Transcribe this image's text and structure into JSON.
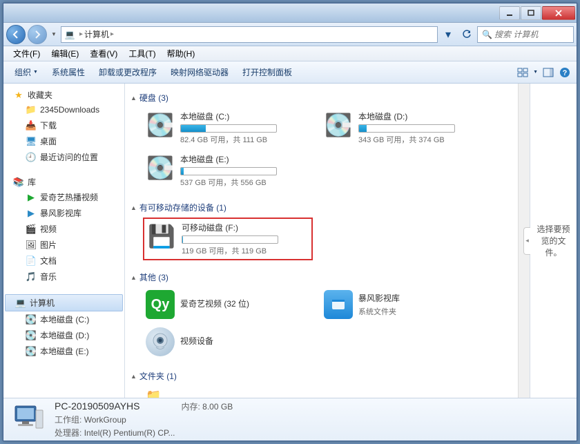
{
  "window": {
    "title": "计算机"
  },
  "nav": {
    "breadcrumb_icon": "💻",
    "breadcrumb": "计算机",
    "search_placeholder": "搜索 计算机"
  },
  "menu": [
    "文件(F)",
    "编辑(E)",
    "查看(V)",
    "工具(T)",
    "帮助(H)"
  ],
  "toolbar": {
    "organize": "组织",
    "sys_props": "系统属性",
    "uninstall": "卸载或更改程序",
    "map_drive": "映射网络驱动器",
    "control_panel": "打开控制面板"
  },
  "sidebar": {
    "favorites": {
      "label": "收藏夹",
      "items": [
        "2345Downloads",
        "下载",
        "桌面",
        "最近访问的位置"
      ]
    },
    "libraries": {
      "label": "库",
      "items": [
        "爱奇艺热播视频",
        "暴风影视库",
        "视频",
        "图片",
        "文档",
        "音乐"
      ]
    },
    "computer": {
      "label": "计算机",
      "items": [
        "本地磁盘 (C:)",
        "本地磁盘 (D:)",
        "本地磁盘 (E:)"
      ]
    }
  },
  "sections": {
    "hdd": {
      "title": "硬盘 (3)",
      "drives": [
        {
          "name": "本地磁盘 (C:)",
          "text": "82.4 GB 可用，共 111 GB",
          "pct": 26
        },
        {
          "name": "本地磁盘 (D:)",
          "text": "343 GB 可用，共 374 GB",
          "pct": 8
        },
        {
          "name": "本地磁盘 (E:)",
          "text": "537 GB 可用，共 556 GB",
          "pct": 3
        }
      ]
    },
    "removable": {
      "title": "有可移动存储的设备 (1)",
      "drives": [
        {
          "name": "可移动磁盘 (F:)",
          "text": "119 GB 可用，共 119 GB",
          "pct": 0
        }
      ]
    },
    "other": {
      "title": "其他 (3)",
      "items": [
        {
          "name": "爱奇艺视频 (32 位)",
          "sub": ""
        },
        {
          "name": "暴风影视库",
          "sub": "系统文件夹"
        },
        {
          "name": "视频设备",
          "sub": ""
        }
      ]
    },
    "folders": {
      "title": "文件夹 (1)"
    }
  },
  "preview": {
    "text": "选择要预览的文件。"
  },
  "details": {
    "name": "PC-20190509AYHS",
    "memory_label": "内存:",
    "memory": "8.00 GB",
    "workgroup_label": "工作组:",
    "workgroup": "WorkGroup",
    "cpu_label": "处理器:",
    "cpu": "Intel(R) Pentium(R) CP..."
  }
}
